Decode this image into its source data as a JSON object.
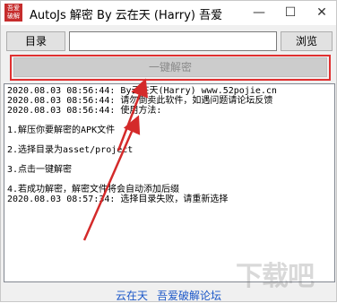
{
  "window": {
    "title": "AutoJs 解密 By 云在天 (Harry) 吾爱",
    "icon_text": "吾爱破解",
    "min_glyph": "—",
    "max_glyph": "☐",
    "close_glyph": "✕"
  },
  "directory": {
    "button_label": "目录",
    "input_value": "",
    "browse_label": "浏览"
  },
  "decrypt": {
    "button_label": "一键解密",
    "highlight_color": "#e03030"
  },
  "log": {
    "lines": [
      "2020.08.03 08:56:44: By云在天(Harry) www.52pojie.cn",
      "2020.08.03 08:56:44: 请勿倒卖此软件，如遇问题请论坛反馈",
      "2020.08.03 08:56:44: 使用方法:",
      "",
      "1.解压你要解密的APK文件",
      "",
      "2.选择目录为asset/project",
      "",
      "3.点击一键解密",
      "",
      "4.若成功解密，解密文件将会自动添加后缀",
      "2020.08.03 08:57:34: 选择目录失败，请重新选择"
    ]
  },
  "footer": {
    "author_link": "云在天",
    "forum_link": "吾爱破解论坛"
  },
  "watermark": {
    "text": "下载吧"
  },
  "colors": {
    "arrow": "#d42a2a",
    "link": "#1a56c8"
  }
}
